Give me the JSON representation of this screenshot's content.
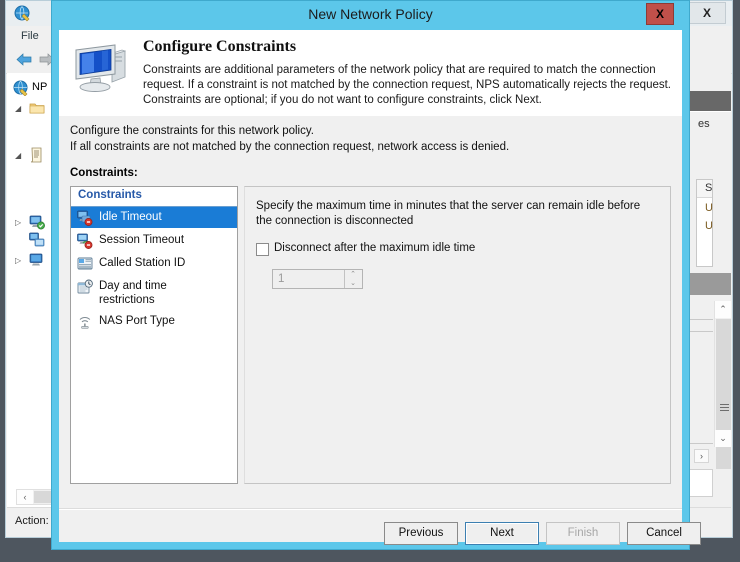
{
  "background": {
    "app_icon": "nps-globe-icon",
    "close_label": "X",
    "menu": [
      {
        "label": "File"
      }
    ],
    "toolbar": {
      "back_icon": "back-arrow-icon",
      "forward_icon": "forward-arrow-icon"
    },
    "tree": [
      {
        "label": "NP",
        "icon": "nps-globe-icon",
        "indent": 0,
        "expander": ""
      },
      {
        "label": "",
        "icon": "folder-icon",
        "indent": 1,
        "expander": "collapse"
      },
      {
        "label": "",
        "icon": "policy-document-icon",
        "indent": 1,
        "expander": "collapse"
      },
      {
        "label": "",
        "icon": "network-policy-ok-icon",
        "indent": 1,
        "expander": "expand"
      },
      {
        "label": "",
        "icon": "connection-request-policy-icon",
        "indent": 2,
        "expander": ""
      },
      {
        "label": "",
        "icon": "computer-icon",
        "indent": 1,
        "expander": "expand"
      }
    ],
    "details": {
      "fragment_text": "es",
      "table_header": "S",
      "table_rows": [
        "U",
        "U"
      ],
      "scroll_up_icon": "scroll-up-icon",
      "scroll_down_icon": "scroll-down-icon",
      "expander_icon": "chevron-right-icon"
    },
    "hscroll": {
      "left_icon": "scroll-left-icon",
      "right_icon": "scroll-right-icon"
    },
    "status": {
      "action_label": "Action:"
    }
  },
  "dialog": {
    "title": "New Network Policy",
    "close_label": "X",
    "header": {
      "icon": "computer-monitor-icon",
      "title": "Configure Constraints",
      "description": "Constraints are additional parameters of the network policy that are required to match the connection request. If a constraint is not matched by the connection request, NPS automatically rejects the request. Constraints are optional; if you do not want to configure constraints, click Next."
    },
    "subheader": {
      "line1": "Configure the constraints for this network policy.",
      "line2": "If all constraints are not matched by the connection request, network access is denied."
    },
    "constraints_label": "Constraints:",
    "list": {
      "header": "Constraints",
      "items": [
        {
          "label": "Idle Timeout",
          "icon": "idle-timeout-icon",
          "selected": true
        },
        {
          "label": "Session Timeout",
          "icon": "session-timeout-icon",
          "selected": false
        },
        {
          "label": "Called Station ID",
          "icon": "called-station-id-icon",
          "selected": false
        },
        {
          "label": "Day and time restrictions",
          "icon": "day-time-restrictions-icon",
          "selected": false
        },
        {
          "label": "NAS Port Type",
          "icon": "nas-port-type-icon",
          "selected": false
        }
      ]
    },
    "detail": {
      "description": "Specify the maximum time in minutes that the server can remain idle before the connection is disconnected",
      "checkbox_label": "Disconnect after the maximum idle time",
      "checkbox_checked": false,
      "spinner_value": "1",
      "spinner_up_icon": "spinner-up-icon",
      "spinner_down_icon": "spinner-down-icon"
    },
    "buttons": {
      "previous": "Previous",
      "next": "Next",
      "finish": "Finish",
      "cancel": "Cancel"
    }
  },
  "colors": {
    "dialog_frame": "#5CC7EA",
    "selection": "#1A7CD6",
    "list_header_text": "#2759A8",
    "close_button": "#C0504A",
    "default_button_border": "#3C7FB1"
  }
}
